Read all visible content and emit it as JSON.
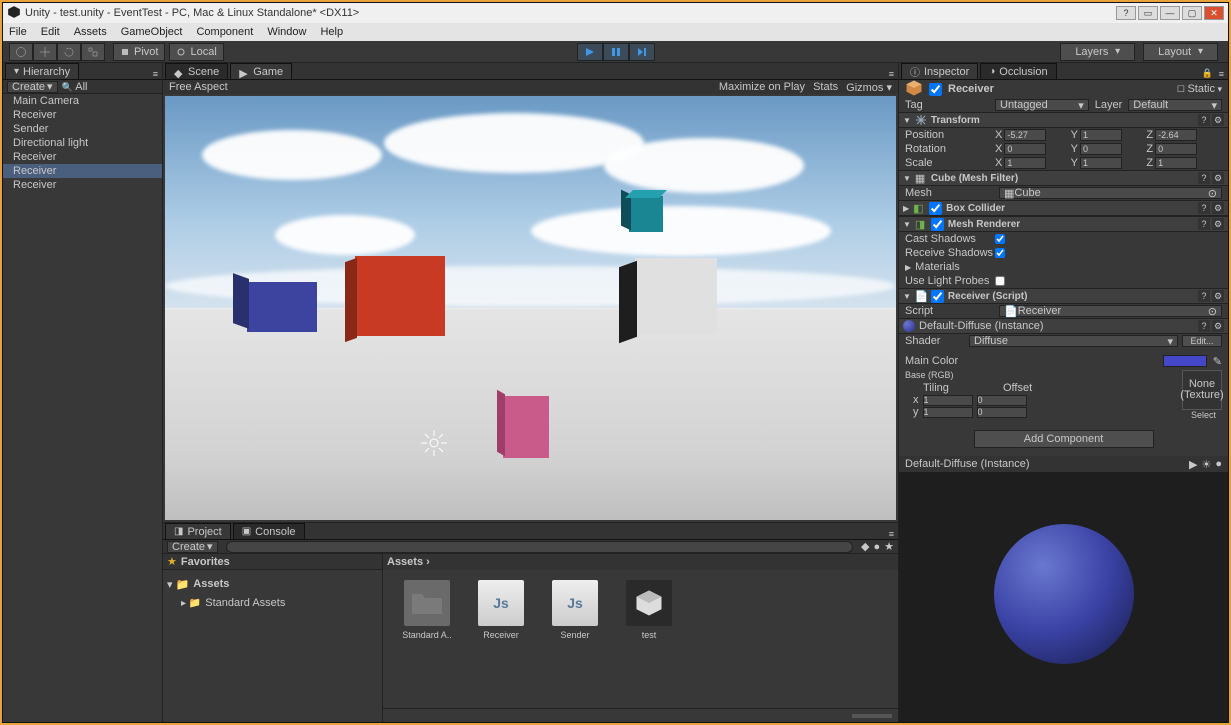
{
  "title": "Unity - test.unity - EventTest - PC, Mac & Linux Standalone* <DX11>",
  "menu": [
    "File",
    "Edit",
    "Assets",
    "GameObject",
    "Component",
    "Window",
    "Help"
  ],
  "toolbar": {
    "pivot": "Pivot",
    "local": "Local",
    "layers": "Layers",
    "layout": "Layout"
  },
  "hierarchy": {
    "tab": "Hierarchy",
    "create": "Create",
    "all": "All",
    "items": [
      {
        "name": "Main Camera",
        "sel": false
      },
      {
        "name": "Receiver",
        "sel": false
      },
      {
        "name": "Sender",
        "sel": false
      },
      {
        "name": "Directional light",
        "sel": false
      },
      {
        "name": "Receiver",
        "sel": false
      },
      {
        "name": "Receiver",
        "sel": true
      },
      {
        "name": "Receiver",
        "sel": false
      }
    ]
  },
  "scene": {
    "tabs": [
      "Scene",
      "Game"
    ],
    "free": "Free Aspect",
    "maximize": "Maximize on Play",
    "stats": "Stats",
    "gizmos": "Gizmos"
  },
  "project": {
    "tabs": [
      "Project",
      "Console"
    ],
    "create": "Create",
    "favorites": "Favorites",
    "assets": "Assets",
    "standard": "Standard Assets",
    "breadcrumb": "Assets ›",
    "items": [
      {
        "name": "Standard A..",
        "type": "folder"
      },
      {
        "name": "Receiver",
        "type": "js"
      },
      {
        "name": "Sender",
        "type": "js"
      },
      {
        "name": "test",
        "type": "unity"
      }
    ]
  },
  "inspector": {
    "tab": "Inspector",
    "occlusion": "Occlusion",
    "name": "Receiver",
    "static": "Static",
    "tag_lbl": "Tag",
    "tag": "Untagged",
    "layer_lbl": "Layer",
    "layer": "Default",
    "transform": {
      "title": "Transform",
      "pos_lbl": "Position",
      "rot_lbl": "Rotation",
      "scale_lbl": "Scale",
      "pos": {
        "x": "-5.27",
        "y": "1",
        "z": "-2.64"
      },
      "rot": {
        "x": "0",
        "y": "0",
        "z": "0"
      },
      "scale": {
        "x": "1",
        "y": "1",
        "z": "1"
      }
    },
    "cube": {
      "title": "Cube (Mesh Filter)",
      "mesh_lbl": "Mesh",
      "mesh": "Cube"
    },
    "boxcol": {
      "title": "Box Collider"
    },
    "renderer": {
      "title": "Mesh Renderer",
      "cast": "Cast Shadows",
      "receive": "Receive Shadows",
      "mats": "Materials",
      "probes": "Use Light Probes"
    },
    "script": {
      "title": "Receiver (Script)",
      "lbl": "Script",
      "val": "Receiver"
    },
    "material": {
      "title": "Default-Diffuse (Instance)",
      "shader_lbl": "Shader",
      "shader": "Diffuse",
      "edit": "Edit...",
      "main_color": "Main Color",
      "base": "Base (RGB)",
      "tiling": "Tiling",
      "offset": "Offset",
      "tx": "1",
      "ty": "1",
      "ox": "0",
      "oy": "0",
      "none": "None (Texture)",
      "select": "Select"
    },
    "addcomp": "Add Component",
    "preview": "Default-Diffuse (Instance)"
  }
}
